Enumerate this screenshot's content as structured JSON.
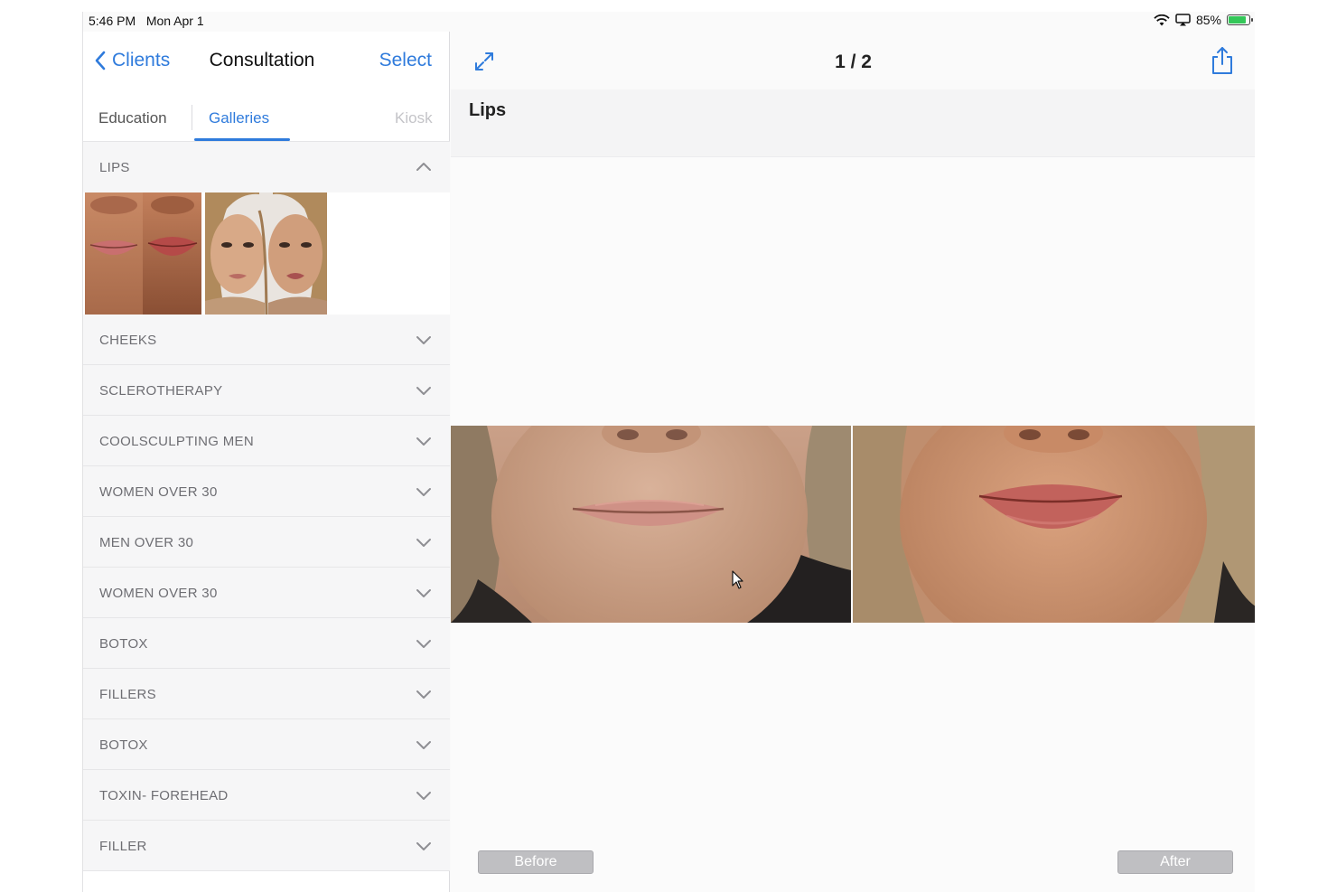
{
  "status_bar": {
    "time": "5:46 PM",
    "date": "Mon Apr 1",
    "battery": "85%",
    "battery_level": 0.85,
    "icons": [
      "wifi-icon",
      "screen-mirroring-icon",
      "battery-icon"
    ]
  },
  "sidebar": {
    "back_label": "Clients",
    "title": "Consultation",
    "select_label": "Select",
    "tabs": [
      {
        "label": "Education",
        "active": false
      },
      {
        "label": "Galleries",
        "active": true
      },
      {
        "label": "Kiosk",
        "active": false
      }
    ],
    "expanded_section": "LIPS",
    "sections": [
      "CHEEKS",
      "SCLEROTHERAPY",
      "COOLSCULPTING MEN",
      "WOMEN OVER 30",
      "MEN OVER 30",
      "WOMEN OVER 30",
      "BOTOX",
      "FILLERS",
      "BOTOX",
      "TOXIN- FOREHEAD",
      "FILLER"
    ]
  },
  "detail": {
    "counter": "1 / 2",
    "title": "Lips",
    "before_label": "Before",
    "after_label": "After"
  },
  "colors": {
    "accent": "#2f7bdc",
    "battery_green": "#34c759",
    "section_text": "#6e6e73"
  }
}
